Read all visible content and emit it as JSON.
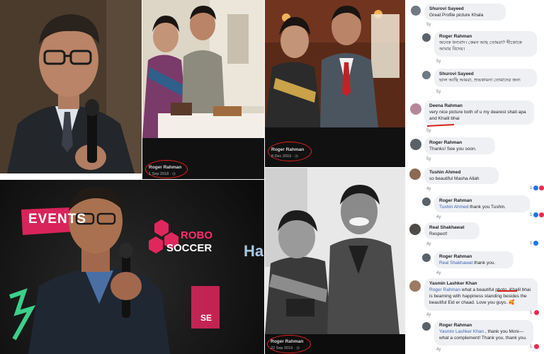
{
  "photos": {
    "couple1": {
      "caption_name": "Roger Rahman",
      "caption_date": "1 Sep 2018 · ◷"
    },
    "couple2": {
      "caption_name": "Roger Rahman",
      "caption_date": "8 Dec 2015 · ◷"
    },
    "bw": {
      "caption_name": "Roger Rahman",
      "caption_date": "22 Sep 2019 · ◷"
    },
    "event": {
      "sign_events": "EVENTS",
      "sign_robo": "ROBO",
      "sign_soccer": "SOCCER",
      "sign_ha": "Ha",
      "sign_se": "SE"
    }
  },
  "comments": [
    {
      "name": "Shurovi Sayeed",
      "text": "Great Profile picture Khala",
      "time": "5y"
    },
    {
      "name": "Roger Rahman",
      "text": "অনেক ধন্যবাদ। কেমন আছ তোমরা? সীকোকে আমার বিদেয়।",
      "time": "5y"
    },
    {
      "name": "Shurovi Sayeed",
      "text": "ভাল আছি আমরা, শুভকামনা তোমাদের জন্য",
      "time": "5y"
    },
    {
      "name": "Deena Rahman",
      "text": "very nice picture both of u my dearest shati apa and Khalil bhai",
      "time": "5y"
    },
    {
      "name": "Roger Rahman",
      "text": "Thanks! See you soon.",
      "time": "5y"
    },
    {
      "name": "Tushin Ahmed",
      "text": "so beautiful Masha Allah",
      "time": "4y",
      "likes": "1"
    },
    {
      "name": "Roger Rahman",
      "mention": "Tushin Ahmed",
      "text": " thank you Tushin.",
      "time": "4y",
      "likes": "1"
    },
    {
      "name": "Real Shakhawat",
      "text": "Respect!",
      "time": "4y",
      "likes": "1"
    },
    {
      "name": "Roger Rahman",
      "mention": "Real Shakhawat",
      "text": " thank you.",
      "time": "4y"
    },
    {
      "name": "Yasmin Lashker Khan",
      "mention": "Roger Rahman",
      "text": " what a beautiful photo. Khalil bhai is beaming with happiness standing besides the beautiful Eid er chaad. Love you guys. 🥰",
      "time": "4y",
      "likes": "1"
    },
    {
      "name": "Roger Rahman",
      "mention": "Yasmin Lashker Khan",
      "text": " , thank you Moni— what a complement! Thank you, thank you.",
      "time": "4y",
      "likes": "1"
    }
  ],
  "colors": {
    "mention": "#3b63b0",
    "bubble": "#eef0f3",
    "caption_circle": "#e0231c",
    "annotation_underline": "#d42020",
    "like_blue": "#1877f2",
    "heart_red": "#f0284a"
  }
}
